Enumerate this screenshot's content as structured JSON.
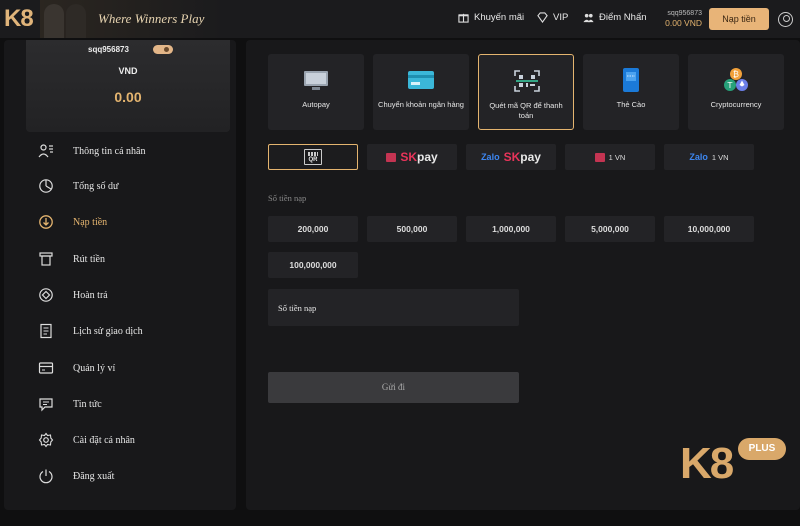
{
  "header": {
    "logo": "K8",
    "slogan": "Where Winners Play",
    "nav": [
      {
        "label": "Khuyến mãi",
        "icon": "gift-icon"
      },
      {
        "label": "VIP",
        "icon": "diamond-icon"
      },
      {
        "label": "Điểm Nhấn",
        "icon": "people-icon"
      }
    ],
    "account": {
      "username": "sqq956873",
      "balance": "0.00 VND"
    },
    "deposit_label": "Nạp tiền"
  },
  "sidebar": {
    "username": "sqq956873",
    "currency": "VND",
    "balance": "0.00",
    "items": [
      {
        "label": "Thông tin cá nhân",
        "icon": "profile-icon"
      },
      {
        "label": "Tổng số dư",
        "icon": "balance-icon"
      },
      {
        "label": "Nạp tiền",
        "icon": "deposit-icon",
        "active": true
      },
      {
        "label": "Rút tiền",
        "icon": "withdraw-icon"
      },
      {
        "label": "Hoàn trả",
        "icon": "rebate-icon"
      },
      {
        "label": "Lịch sử giao dịch",
        "icon": "history-icon"
      },
      {
        "label": "Quản lý ví",
        "icon": "wallet-icon"
      },
      {
        "label": "Tin tức",
        "icon": "chat-icon"
      },
      {
        "label": "Cài đặt cá nhân",
        "icon": "settings-icon"
      },
      {
        "label": "Đăng xuất",
        "icon": "logout-icon"
      }
    ]
  },
  "main": {
    "methods": [
      {
        "label": "Autopay",
        "icon": "monitor-icon"
      },
      {
        "label": "Chuyển khoản ngân hàng",
        "icon": "bank-card-icon"
      },
      {
        "label": "Quét mã QR để thanh toán",
        "icon": "qr-scan-icon",
        "selected": true
      },
      {
        "label": "Thẻ Cào",
        "icon": "scratch-card-icon"
      },
      {
        "label": "Cryptocurrency",
        "icon": "crypto-icon"
      }
    ],
    "sub_methods": [
      {
        "label": "QR",
        "selected": true
      },
      {
        "label": "SK",
        "label2": "pay"
      },
      {
        "label": "Zalo",
        "label2": "SK",
        "label3": "pay"
      },
      {
        "label": "1 VN"
      },
      {
        "label": "Zalo",
        "label2": "1 VN"
      }
    ],
    "amount_label": "Số tiền nạp",
    "amounts": [
      "200,000",
      "500,000",
      "1,000,000",
      "5,000,000",
      "10,000,000",
      "100,000,000"
    ],
    "amount_placeholder": "Số tiền nạp",
    "submit_label": "Gửi đi",
    "brand": {
      "logo": "K8",
      "badge": "PLUS"
    }
  },
  "colors": {
    "accent": "#e4b46f",
    "button": "#e8b478",
    "panel": "#18181a",
    "tile": "#232326"
  }
}
